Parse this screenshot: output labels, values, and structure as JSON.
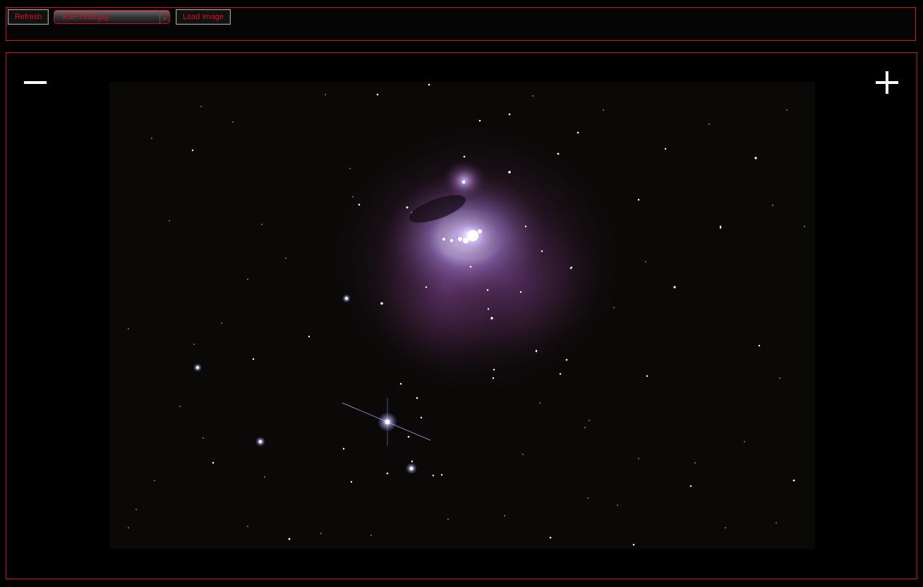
{
  "toolbar": {
    "refresh_label": "Refresh",
    "file_select_value": "KSP7968.jpg",
    "load_label": "Load Image"
  },
  "viewer": {
    "zoom_out_icon": "minus-icon",
    "zoom_in_icon": "plus-icon"
  },
  "colors": {
    "accent": "#c8102e",
    "label_text": "#d4111f",
    "background": "#000000"
  }
}
